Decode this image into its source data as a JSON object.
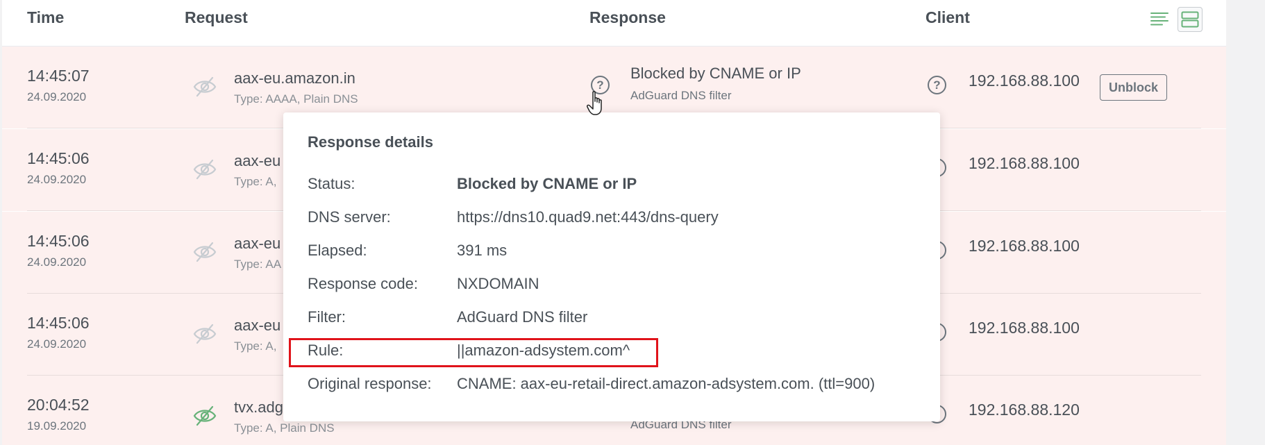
{
  "header": {
    "time": "Time",
    "request": "Request",
    "response": "Response",
    "client": "Client"
  },
  "view_icons": [
    "list-view-icon",
    "detailed-view-icon"
  ],
  "rows": [
    {
      "time": "14:45:07",
      "date": "24.09.2020",
      "domain": "aax-eu.amazon.in",
      "req_type": "Type: AAAA, Plain DNS",
      "status": "Blocked by CNAME or IP",
      "filter": "AdGuard DNS filter",
      "client": "192.168.88.100",
      "eye": "crossed-eye-icon",
      "eye_color": "#c7ccd1"
    },
    {
      "time": "14:45:06",
      "date": "24.09.2020",
      "domain": "aax-eu",
      "req_type": "Type: A,",
      "client": "192.168.88.100",
      "eye": "crossed-eye-icon",
      "eye_color": "#c7ccd1"
    },
    {
      "time": "14:45:06",
      "date": "24.09.2020",
      "domain": "aax-eu",
      "req_type": "Type: AA",
      "client": "192.168.88.100",
      "eye": "crossed-eye-icon",
      "eye_color": "#c7ccd1"
    },
    {
      "time": "14:45:06",
      "date": "24.09.2020",
      "domain": "aax-eu",
      "req_type": "Type: A,",
      "client": "192.168.88.100",
      "eye": "crossed-eye-icon",
      "eye_color": "#c7ccd1"
    },
    {
      "time": "20:04:52",
      "date": "19.09.2020",
      "domain": "tvx.adg",
      "req_type": "Type: A, Plain DNS",
      "filter": "AdGuard DNS filter",
      "client": "192.168.88.120",
      "eye": "crossed-eye-icon",
      "eye_color": "#67b279"
    }
  ],
  "unblock_label": "Unblock",
  "popup": {
    "title": "Response details",
    "status_label": "Status:",
    "status_value": "Blocked by CNAME or IP",
    "dns_server_label": "DNS server:",
    "dns_server_value": "https://dns10.quad9.net:443/dns-query",
    "elapsed_label": "Elapsed:",
    "elapsed_value": "391 ms",
    "response_code_label": "Response code:",
    "response_code_value": "NXDOMAIN",
    "filter_label": "Filter:",
    "filter_value": "AdGuard DNS filter",
    "rule_label": "Rule:",
    "rule_value": "||amazon-adsystem.com^",
    "original_label": "Original response:",
    "original_value": "CNAME: aax-eu-retail-direct.amazon-adsystem.com. (ttl=900)"
  },
  "colors": {
    "blocked_row_bg": "#fdf0ef",
    "highlight_border": "#e0131a",
    "list_icon": "#67b279",
    "grid_icon": "#67b279"
  }
}
